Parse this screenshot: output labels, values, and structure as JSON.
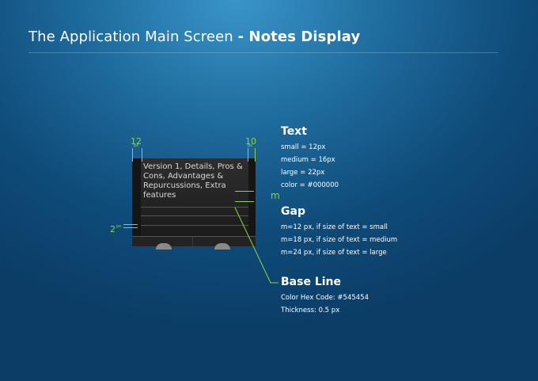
{
  "title": {
    "light": "The Application Main Screen",
    "bold": "- Notes Display"
  },
  "note": {
    "text": "Version 1, Details, Pros & Cons, Advantages & Repurcussions, Extra features"
  },
  "annotations": {
    "left_margin": {
      "value": "12",
      "unit": "px"
    },
    "right_margin": {
      "value": "10",
      "unit": "px"
    },
    "line_offset": {
      "value": "2",
      "unit": "px"
    },
    "gap": "m"
  },
  "sections": {
    "text": {
      "heading": "Text",
      "lines": [
        "small = 12px",
        "medium = 16px",
        "large = 22px",
        "color = #000000"
      ]
    },
    "gap": {
      "heading": "Gap",
      "lines": [
        "m=12 px, if size of text = small",
        "m=18 px, if size of text = medium",
        "m=24 px, if size of text = large"
      ]
    },
    "base_line": {
      "heading": "Base Line",
      "lines": [
        "Color Hex Code: #545454",
        "Thickness: 0.5 px"
      ]
    }
  },
  "colors": {
    "annotation": "#8fd14f",
    "base_line": "#545454",
    "text": "#000000"
  }
}
